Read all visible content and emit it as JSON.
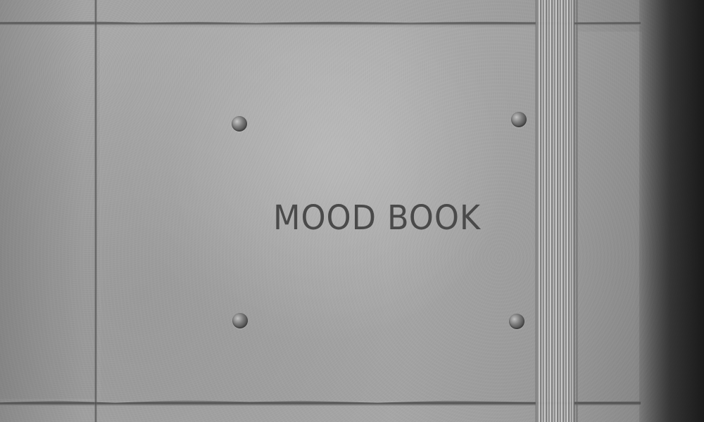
{
  "cover": {
    "title": "MOOD BOOK"
  }
}
